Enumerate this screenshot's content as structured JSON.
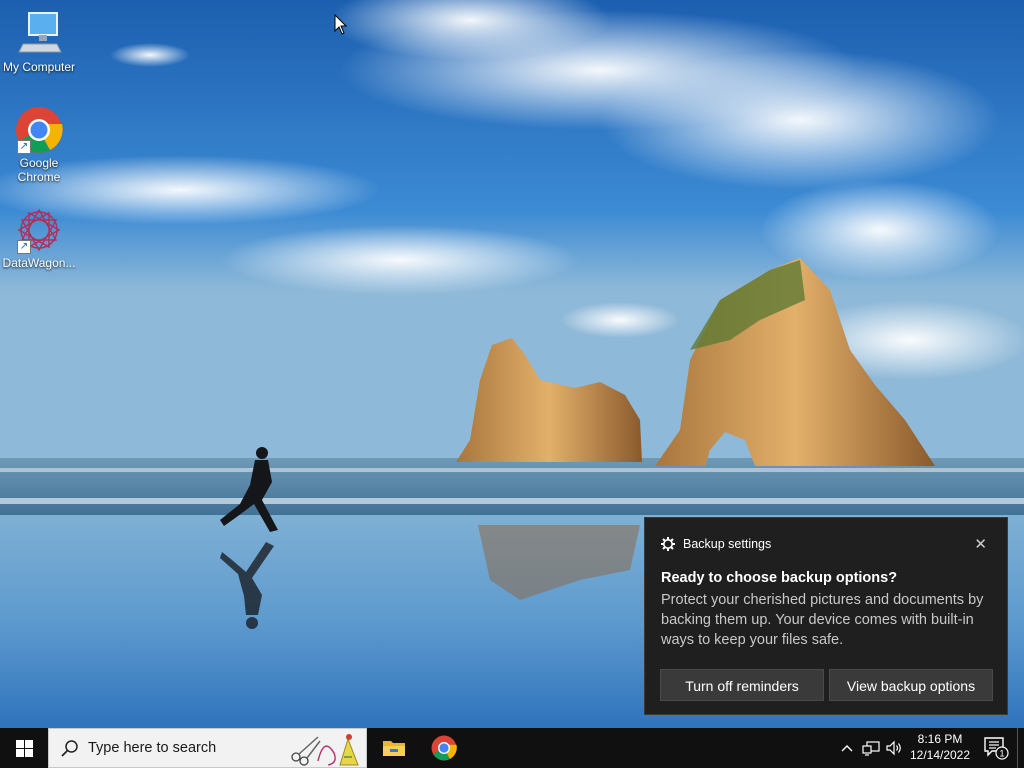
{
  "desktop": {
    "icons": [
      {
        "label": "My Computer"
      },
      {
        "label": "Google Chrome"
      },
      {
        "label": "DataWagon..."
      }
    ]
  },
  "toast": {
    "app_name": "Backup settings",
    "close_label": "✕",
    "title": "Ready to choose backup options?",
    "body": "Protect your cherished pictures and documents by backing them up. Your device comes with built-in ways to keep your files safe.",
    "buttons": {
      "turn_off": "Turn off reminders",
      "view": "View backup options"
    }
  },
  "taskbar": {
    "search_placeholder": "Type here to search",
    "pinned": [
      "File Explorer",
      "Google Chrome"
    ],
    "clock": {
      "time": "8:16 PM",
      "date": "12/14/2022"
    },
    "notification_count": "1"
  },
  "colors": {
    "taskbar": "#101010",
    "toast_bg": "#1f1f1f",
    "toast_button": "#3a3a3a"
  }
}
